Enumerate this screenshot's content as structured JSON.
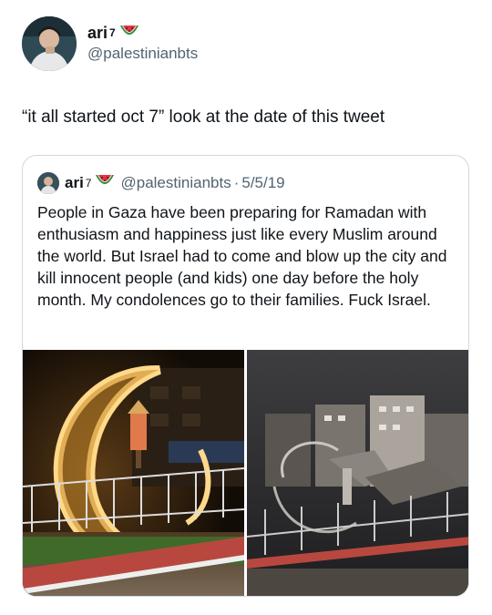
{
  "tweet": {
    "display_name": "ari",
    "superscript": "7",
    "handle": "@palestinianbts",
    "text": "“it all started oct 7” look at the date of this tweet"
  },
  "quoted_tweet": {
    "display_name": "ari",
    "superscript": "7",
    "handle": "@palestinianbts",
    "separator": "·",
    "date": "5/5/19",
    "text": "People in Gaza have been preparing for Ramadan with enthusiasm and happiness just like every Muslim around the world. But Israel had to come and blow up the city and kill innocent people (and kids) one day before the holy month. My condolences go to their families. Fuck Israel."
  },
  "icons": {
    "emoji": "watermelon-icon"
  },
  "colors": {
    "text": "#0f1419",
    "secondary": "#536471",
    "border": "#cfd9de"
  }
}
